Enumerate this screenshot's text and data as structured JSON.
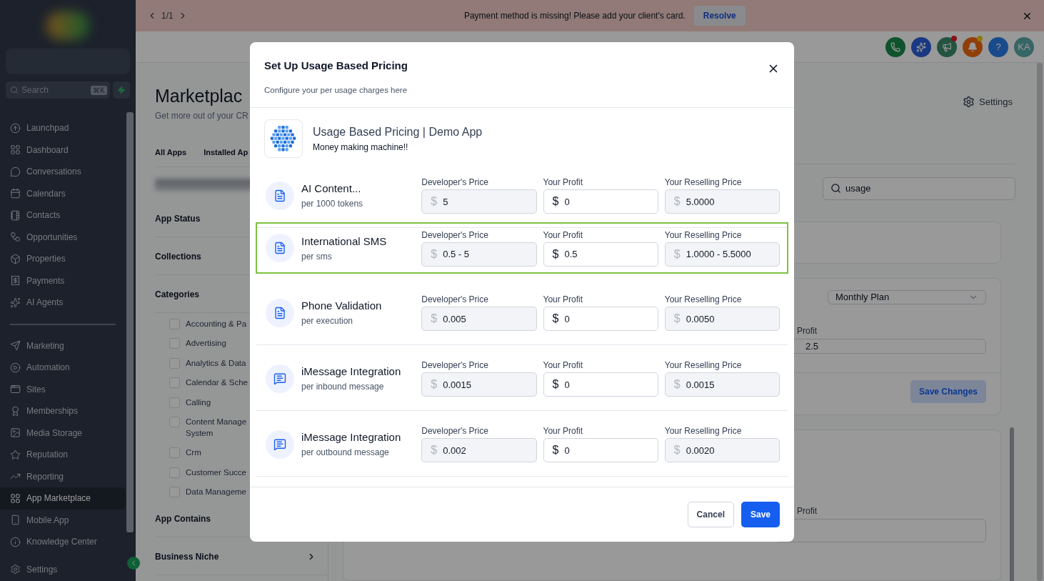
{
  "banner": {
    "pager": "1/1",
    "message": "Payment method is missing! Please add your client's card.",
    "action": "Resolve"
  },
  "sidebar": {
    "search": {
      "placeholder": "Search",
      "shortcut": "⌘K"
    },
    "groups": [
      [
        {
          "label": "Launchpad",
          "selected": false
        },
        {
          "label": "Dashboard",
          "selected": false
        },
        {
          "label": "Conversations",
          "selected": false
        },
        {
          "label": "Calendars",
          "selected": false
        },
        {
          "label": "Contacts",
          "selected": false
        },
        {
          "label": "Opportunities",
          "selected": false
        },
        {
          "label": "Properties",
          "selected": false
        },
        {
          "label": "Payments",
          "selected": false
        },
        {
          "label": "AI Agents",
          "selected": false
        }
      ],
      [
        {
          "label": "Marketing",
          "selected": false
        },
        {
          "label": "Automation",
          "selected": false
        },
        {
          "label": "Sites",
          "selected": false
        },
        {
          "label": "Memberships",
          "selected": false
        },
        {
          "label": "Media Storage",
          "selected": false
        },
        {
          "label": "Reputation",
          "selected": false
        },
        {
          "label": "Reporting",
          "selected": false
        },
        {
          "label": "App Marketplace",
          "selected": true
        },
        {
          "label": "Mobile App",
          "selected": false
        },
        {
          "label": "Knowledge Center",
          "selected": false
        }
      ]
    ],
    "settings": "Settings"
  },
  "header": {
    "help": "?",
    "avatar": "KA"
  },
  "marketplace": {
    "title": "Marketplac",
    "subtitle": "Get more out of your CR",
    "tabs": [
      "All Apps",
      "Installed Ap"
    ],
    "sections": [
      {
        "title": "App Status"
      },
      {
        "title": "Collections"
      },
      {
        "title": "Categories",
        "options": [
          {
            "label": "Accounting & Pa",
            "checked": false
          },
          {
            "label": "Advertising",
            "checked": false
          },
          {
            "label": "Analytics & Data",
            "checked": false
          },
          {
            "label": "Calendar & Sche",
            "checked": false
          },
          {
            "label": "Calling",
            "checked": false
          },
          {
            "label": "Content Manage System",
            "checked": false
          },
          {
            "label": "Crm",
            "checked": false
          },
          {
            "label": "Customer Succe",
            "checked": false
          },
          {
            "label": "Data Manageme",
            "checked": false
          }
        ]
      },
      {
        "title": "App Contains"
      },
      {
        "title": "Business Niche"
      }
    ],
    "settings": "Settings",
    "search": "usage",
    "plan": "Monthly Plan",
    "profit_label": "Profit",
    "profit_value": "2.5",
    "save": "Save Changes",
    "profit_label_2": "Profit"
  },
  "modal": {
    "title": "Set Up Usage Based Pricing",
    "subtitle": "Configure your per usage charges here",
    "app": {
      "name": "Usage Based Pricing | Demo App",
      "tagline": "Money making machine!!"
    },
    "rows": [
      {
        "kind": "document",
        "name": "AI Content...",
        "unit": "per 1000 tokens",
        "highlighted": false,
        "fields": [
          {
            "label": "Developer's Price",
            "currency": "$",
            "value": "5",
            "disabled": true
          },
          {
            "label": "Your Profit",
            "currency": "$",
            "value": "0",
            "disabled": false
          },
          {
            "label": "Your Reselling Price",
            "currency": "$",
            "value": "5.0000",
            "disabled": true
          }
        ]
      },
      {
        "kind": "document",
        "name": "International SMS",
        "unit": "per sms",
        "highlighted": true,
        "fields": [
          {
            "label": "Developer's Price",
            "currency": "$",
            "value": "0.5 - 5",
            "disabled": true
          },
          {
            "label": "Your Profit",
            "currency": "$",
            "value": "0.5",
            "disabled": false
          },
          {
            "label": "Your Reselling Price",
            "currency": "$",
            "value": "1.0000 - 5.5000",
            "disabled": true
          }
        ]
      },
      {
        "kind": "document",
        "name": "Phone Validation",
        "unit": "per execution",
        "highlighted": false,
        "fields": [
          {
            "label": "Developer's Price",
            "currency": "$",
            "value": "0.005",
            "disabled": true
          },
          {
            "label": "Your Profit",
            "currency": "$",
            "value": "0",
            "disabled": false
          },
          {
            "label": "Your Reselling Price",
            "currency": "$",
            "value": "0.0050",
            "disabled": true
          }
        ]
      },
      {
        "kind": "chat",
        "name": "iMessage Integration",
        "unit": "per inbound message",
        "highlighted": false,
        "fields": [
          {
            "label": "Developer's Price",
            "currency": "$",
            "value": "0.0015",
            "disabled": true
          },
          {
            "label": "Your Profit",
            "currency": "$",
            "value": "0",
            "disabled": false
          },
          {
            "label": "Your Reselling Price",
            "currency": "$",
            "value": "0.0015",
            "disabled": true
          }
        ]
      },
      {
        "kind": "chat",
        "name": "iMessage Integration",
        "unit": "per outbound message",
        "highlighted": false,
        "fields": [
          {
            "label": "Developer's Price",
            "currency": "$",
            "value": "0.002",
            "disabled": true
          },
          {
            "label": "Your Profit",
            "currency": "$",
            "value": "0",
            "disabled": false
          },
          {
            "label": "Your Reselling Price",
            "currency": "$",
            "value": "0.0020",
            "disabled": true
          }
        ]
      }
    ],
    "cancel": "Cancel",
    "save": "Save"
  }
}
